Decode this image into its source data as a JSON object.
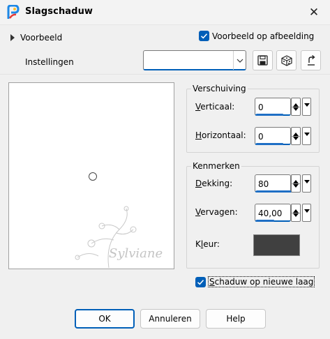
{
  "window": {
    "title": "Slagschaduw",
    "close_glyph": "✕"
  },
  "top": {
    "preview_label": "Voorbeeld",
    "preview_on_image_label": "Voorbeeld op afbeelding",
    "preview_on_image_checked": true,
    "settings_label": "Instellingen",
    "settings_value": ""
  },
  "icons": {
    "app": "paintshop-pro-icon",
    "save": "floppy-disk-icon",
    "dice": "dice-icon",
    "reset": "reset-arrow-icon"
  },
  "offset_group": {
    "title": "Verschuiving",
    "vertical_label_ul": "V",
    "vertical_label_rest": "erticaal:",
    "vertical_value": "0",
    "horizontal_label_ul": "H",
    "horizontal_label_rest": "orizontaal:",
    "horizontal_value": "0"
  },
  "props_group": {
    "title": "Kenmerken",
    "opacity_label_ul": "D",
    "opacity_label_rest": "ekking:",
    "opacity_value": "80",
    "opacity_level": 0.8,
    "blur_label_ul": "V",
    "blur_label_rest": "ervagen:",
    "blur_value": "40,00",
    "blur_level": 0.4,
    "color_label_ul": "l",
    "color_label_pre": "K",
    "color_label_rest": "eur:",
    "color": "#404040"
  },
  "new_layer": {
    "label_ul": "S",
    "label_rest": "chaduw op nieuwe laag",
    "checked": true
  },
  "buttons": {
    "ok": "OK",
    "cancel": "Annuleren",
    "help": "Help"
  },
  "colors": {
    "accent": "#005fb8"
  }
}
